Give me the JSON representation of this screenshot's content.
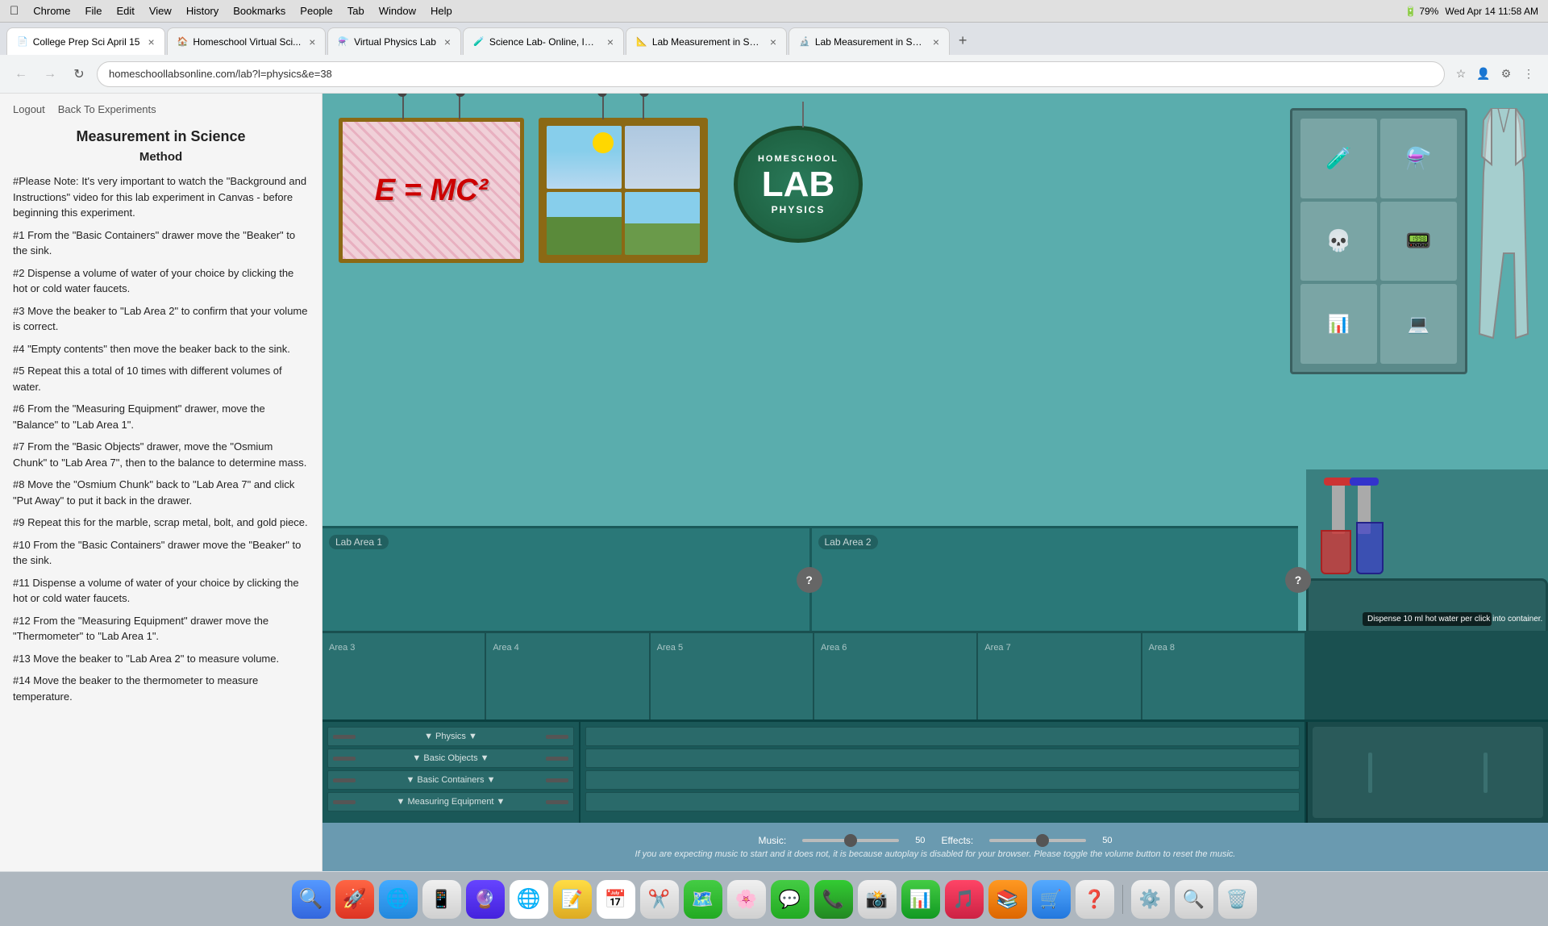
{
  "menubar": {
    "apple": "⌘",
    "items": [
      "Chrome",
      "File",
      "Edit",
      "View",
      "History",
      "Bookmarks",
      "People",
      "Tab",
      "Window",
      "Help"
    ],
    "right": "Wed Apr 14  11:58 AM"
  },
  "tabs": [
    {
      "id": "tab1",
      "favicon": "📄",
      "title": "College Prep Sci April 15",
      "active": true
    },
    {
      "id": "tab2",
      "favicon": "🏠",
      "title": "Homeschool Virtual Sci...",
      "active": false
    },
    {
      "id": "tab3",
      "favicon": "🔬",
      "title": "Virtual Physics Lab",
      "active": false
    },
    {
      "id": "tab4",
      "favicon": "🧪",
      "title": "Science Lab- Online, Int...",
      "active": false
    },
    {
      "id": "tab5",
      "favicon": "⚗️",
      "title": "Lab Measurement in Sci...",
      "active": false
    },
    {
      "id": "tab6",
      "favicon": "📐",
      "title": "Lab Measurement in Sci...",
      "active": false
    }
  ],
  "browser": {
    "url": "homeschoollabsonline.com/lab?l=physics&e=38",
    "back_btn": "←",
    "forward_btn": "→",
    "refresh_btn": "↻"
  },
  "sidebar": {
    "nav": {
      "logout": "Logout",
      "back": "Back To Experiments"
    },
    "title": "Measurement in Science",
    "subtitle": "Method",
    "instructions": [
      "#Please Note: It's very important to watch the \"Background and Instructions\" video for this lab experiment in Canvas - before beginning this experiment.",
      "#1 From the \"Basic Containers\" drawer move the \"Beaker\" to the sink.",
      "#2 Dispense a volume of water of your choice by clicking the hot or cold water faucets.",
      "#3 Move the beaker to \"Lab Area 2\" to confirm that your volume is correct.",
      "#4 \"Empty contents\" then move the beaker back to the sink.",
      "#5 Repeat this a total of 10 times with different volumes of water.",
      "#6 From the \"Measuring Equipment\" drawer, move the \"Balance\" to \"Lab Area 1\".",
      "#7 From the \"Basic Objects\" drawer, move the \"Osmium Chunk\" to \"Lab Area 7\", then to the balance to determine mass.",
      "#8 Move the \"Osmium Chunk\" back to \"Lab Area 7\" and click \"Put Away\" to put it back in the drawer.",
      "#9 Repeat this for the marble, scrap metal, bolt, and gold piece.",
      "#10 From the \"Basic Containers\" drawer move the \"Beaker\" to the sink.",
      "#11 Dispense a volume of water of your choice by clicking the hot or cold water faucets.",
      "#12 From the \"Measuring Equipment\" drawer move the \"Thermometer\" to \"Lab Area 1\".",
      "#13 Move the beaker to \"Lab Area 2\" to measure volume.",
      "#14 Move the beaker to the thermometer to measure temperature."
    ]
  },
  "lab": {
    "area1_label": "Lab Area 1",
    "area2_label": "Lab Area 2",
    "areas": [
      "Area 3",
      "Area 4",
      "Area 5",
      "Area 6",
      "Area 7",
      "Area 8"
    ],
    "sign_top": "HOMESCHOOL",
    "sign_lab": "LAB",
    "sign_physics": "PHYSICS",
    "einstein_formula": "E = MC²",
    "drawers": [
      {
        "label": "Physics",
        "arrow": "▼"
      },
      {
        "label": "Basic Objects",
        "arrow": "▼"
      },
      {
        "label": "Basic Containers",
        "arrow": "▼"
      },
      {
        "label": "Measuring Equipment",
        "arrow": "▼"
      }
    ],
    "dispense_text": "Dispense 10 ml hot water per\nclick into container.",
    "music_label": "Music:",
    "music_value": "50",
    "effects_label": "Effects:",
    "effects_value": "50",
    "autoplay_notice": "If you are expecting music to start and it does not, it is because autoplay is disabled for your browser. Please toggle the volume button to reset the music."
  },
  "dock": [
    {
      "icon": "🔍",
      "name": "finder"
    },
    {
      "icon": "🚀",
      "name": "launchpad"
    },
    {
      "icon": "🌐",
      "name": "safari"
    },
    {
      "icon": "💻",
      "name": "apps"
    },
    {
      "icon": "📱",
      "name": "launchpad2"
    },
    {
      "icon": "🔍",
      "name": "spotlight"
    },
    {
      "icon": "🌐",
      "name": "chrome"
    },
    {
      "icon": "📁",
      "name": "notes"
    },
    {
      "icon": "📅",
      "name": "calendar"
    },
    {
      "icon": "📝",
      "name": "notes2"
    },
    {
      "icon": "✂️",
      "name": "clips"
    },
    {
      "icon": "🗺️",
      "name": "maps"
    },
    {
      "icon": "🖼️",
      "name": "photos"
    },
    {
      "icon": "💬",
      "name": "messages"
    },
    {
      "icon": "📞",
      "name": "facetime"
    },
    {
      "icon": "📸",
      "name": "photobooth"
    },
    {
      "icon": "📊",
      "name": "numbers"
    },
    {
      "icon": "🎵",
      "name": "music"
    },
    {
      "icon": "📚",
      "name": "books"
    },
    {
      "icon": "🛒",
      "name": "appstore"
    },
    {
      "icon": "❓",
      "name": "help"
    },
    {
      "icon": "⚙️",
      "name": "systemprefs"
    },
    {
      "icon": "🔍",
      "name": "spotlight2"
    },
    {
      "icon": "🗑️",
      "name": "trash"
    }
  ]
}
